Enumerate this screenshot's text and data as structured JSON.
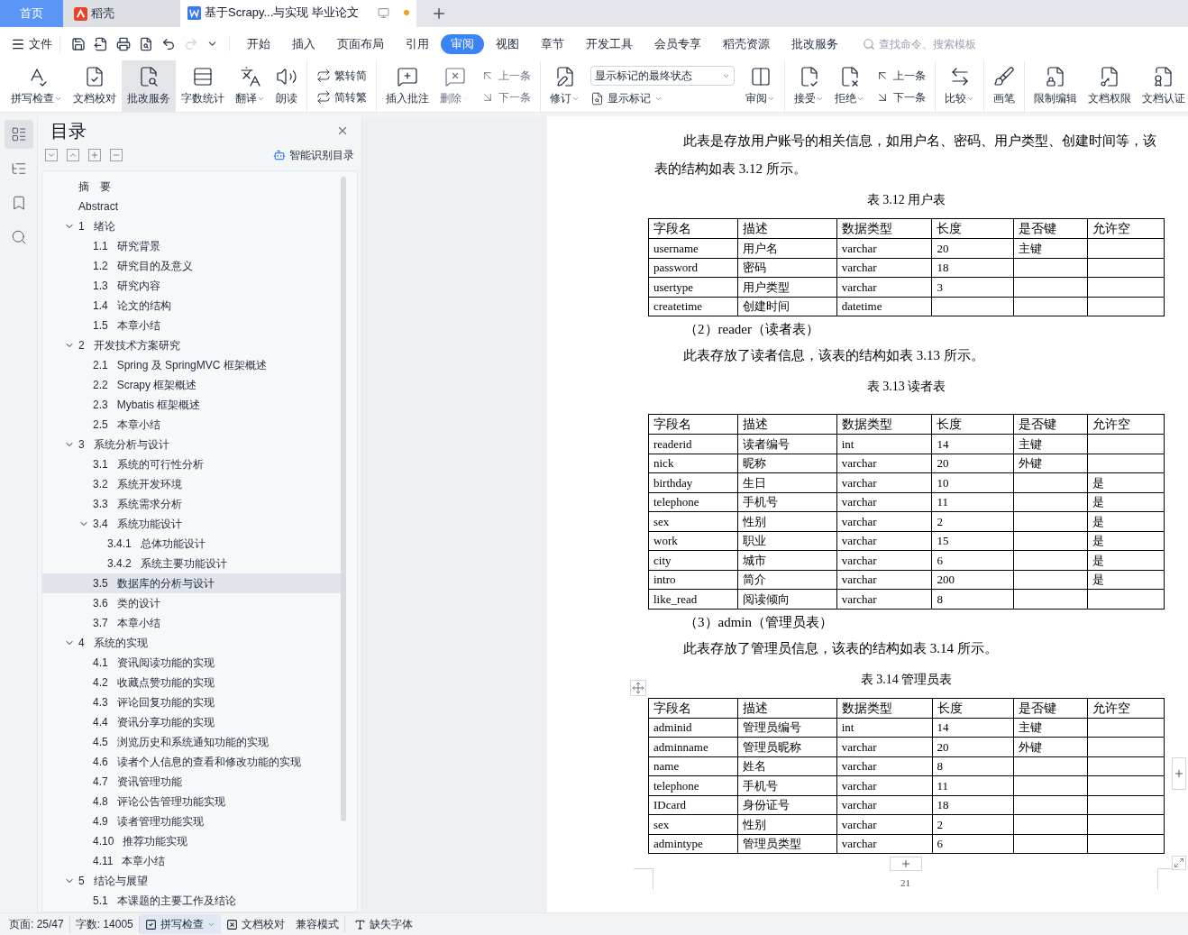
{
  "tabs": [
    {
      "kind": "home",
      "label": "首页",
      "selected": false
    },
    {
      "kind": "app",
      "label": "稻壳",
      "selected": false
    },
    {
      "kind": "doc",
      "label": "基于Scrapy...与实现 毕业论文",
      "selected": true,
      "modified": true
    }
  ],
  "menu": {
    "file": "文件",
    "ribbon_tabs": [
      {
        "label": "开始",
        "selected": false
      },
      {
        "label": "插入",
        "selected": false
      },
      {
        "label": "页面布局",
        "selected": false
      },
      {
        "label": "引用",
        "selected": false
      },
      {
        "label": "审阅",
        "selected": true
      },
      {
        "label": "视图",
        "selected": false
      },
      {
        "label": "章节",
        "selected": false
      },
      {
        "label": "开发工具",
        "selected": false
      },
      {
        "label": "会员专享",
        "selected": false
      },
      {
        "label": "稻壳资源",
        "selected": false
      },
      {
        "label": "批改服务",
        "selected": false
      }
    ],
    "search": {
      "placeholder": "查找命令、搜索模板"
    }
  },
  "ribbon": [
    [
      {
        "kind": "large",
        "label": "拼写检查",
        "caret": true,
        "disabled": false,
        "selected": false
      },
      {
        "kind": "large",
        "label": "文档校对",
        "caret": false,
        "disabled": false,
        "selected": false
      },
      {
        "kind": "large",
        "label": "批改服务",
        "caret": false,
        "disabled": false,
        "selected": true
      },
      {
        "kind": "large",
        "label": "字数统计",
        "caret": false,
        "disabled": false,
        "selected": false
      },
      {
        "kind": "large",
        "label": "翻译",
        "caret": true,
        "disabled": false,
        "selected": false
      },
      {
        "kind": "large",
        "label": "朗读",
        "caret": false,
        "disabled": false,
        "selected": false
      }
    ],
    [
      {
        "kind": "stack",
        "items": [
          {
            "label": "繁转简",
            "disabled": false
          },
          {
            "label": "简转繁",
            "disabled": false
          }
        ]
      }
    ],
    [
      {
        "kind": "large",
        "label": "插入批注",
        "caret": false,
        "disabled": false,
        "selected": false
      },
      {
        "kind": "large",
        "label": "删除",
        "caret": true,
        "disabled": true,
        "selected": false
      },
      {
        "kind": "stack",
        "items": [
          {
            "label": "上一条",
            "disabled": true
          },
          {
            "label": "下一条",
            "disabled": true
          }
        ]
      }
    ],
    [
      {
        "kind": "large",
        "label": "修订",
        "caret": true,
        "disabled": false,
        "selected": false
      },
      {
        "kind": "select",
        "value": "显示标记的最终状态",
        "label": "显示标记"
      },
      {
        "kind": "large",
        "label": "审阅",
        "caret": true,
        "disabled": false,
        "selected": false
      }
    ],
    [
      {
        "kind": "large",
        "label": "接受",
        "caret": true,
        "disabled": false,
        "selected": false
      },
      {
        "kind": "large",
        "label": "拒绝",
        "caret": true,
        "disabled": false,
        "selected": false
      },
      {
        "kind": "stack",
        "items": [
          {
            "label": "上一条",
            "disabled": false
          },
          {
            "label": "下一条",
            "disabled": false
          }
        ]
      }
    ],
    [
      {
        "kind": "large",
        "label": "比较",
        "caret": true,
        "disabled": false,
        "selected": false
      }
    ],
    [
      {
        "kind": "large",
        "label": "画笔",
        "caret": false,
        "disabled": false,
        "selected": false
      }
    ],
    [
      {
        "kind": "large",
        "label": "限制编辑",
        "caret": false,
        "disabled": false,
        "selected": false
      },
      {
        "kind": "large",
        "label": "文档权限",
        "caret": false,
        "disabled": false,
        "selected": false
      },
      {
        "kind": "large",
        "label": "文档认证",
        "caret": false,
        "disabled": false,
        "selected": false
      }
    ]
  ],
  "sidebar": {
    "icons": [
      {
        "selected": true
      },
      {
        "selected": false
      },
      {
        "selected": false
      },
      {
        "selected": false
      }
    ]
  },
  "toc": {
    "title": "目录",
    "smart_button": "智能识别目录",
    "items": [
      {
        "number": "摘　要",
        "selected": false
      },
      {
        "number": "Abstract",
        "selected": false
      },
      {
        "number": "1",
        "title": "绪论",
        "selected": false,
        "expanded": true,
        "children": [
          {
            "number": "1.1",
            "title": "研究背景",
            "selected": false
          },
          {
            "number": "1.2",
            "title": "研究目的及意义",
            "selected": false
          },
          {
            "number": "1.3",
            "title": "研究内容",
            "selected": false
          },
          {
            "number": "1.4",
            "title": "论文的结构",
            "selected": false
          },
          {
            "number": "1.5",
            "title": "本章小结",
            "selected": false
          }
        ]
      },
      {
        "number": "2",
        "title": "开发技术方案研究",
        "selected": false,
        "expanded": true,
        "children": [
          {
            "number": "2.1",
            "title": "Spring 及 SpringMVC 框架概述",
            "selected": false
          },
          {
            "number": "2.2",
            "title": "Scrapy 框架概述",
            "selected": false
          },
          {
            "number": "2.3",
            "title": "Mybatis 框架概述",
            "selected": false
          },
          {
            "number": "2.5",
            "title": "本章小结",
            "selected": false
          }
        ]
      },
      {
        "number": "3",
        "title": "系统分析与设计",
        "selected": false,
        "expanded": true,
        "children": [
          {
            "number": "3.1",
            "title": "系统的可行性分析",
            "selected": false
          },
          {
            "number": "3.2",
            "title": "系统开发环境",
            "selected": false
          },
          {
            "number": "3.3",
            "title": "系统需求分析",
            "selected": false
          },
          {
            "number": "3.4",
            "title": "系统功能设计",
            "selected": false,
            "expanded": true,
            "children": [
              {
                "number": "3.4.1",
                "title": "总体功能设计",
                "selected": false
              },
              {
                "number": "3.4.2",
                "title": "系统主要功能设计",
                "selected": false
              }
            ]
          },
          {
            "number": "3.5",
            "title": "数据库的分析与设计",
            "selected": true
          },
          {
            "number": "3.6",
            "title": "类的设计",
            "selected": false
          },
          {
            "number": "3.7",
            "title": "本章小结",
            "selected": false
          }
        ]
      },
      {
        "number": "4",
        "title": "系统的实现",
        "selected": false,
        "expanded": true,
        "children": [
          {
            "number": "4.1",
            "title": "资讯阅读功能的实现",
            "selected": false
          },
          {
            "number": "4.2",
            "title": "收藏点赞功能的实现",
            "selected": false
          },
          {
            "number": "4.3",
            "title": "评论回复功能的实现",
            "selected": false
          },
          {
            "number": "4.4",
            "title": "资讯分享功能的实现",
            "selected": false
          },
          {
            "number": "4.5",
            "title": "浏览历史和系统通知功能的实现",
            "selected": false
          },
          {
            "number": "4.6",
            "title": "读者个人信息的查看和修改功能的实现",
            "selected": false
          },
          {
            "number": "4.7",
            "title": "资讯管理功能",
            "selected": false
          },
          {
            "number": "4.8",
            "title": "评论公告管理功能实现",
            "selected": false
          },
          {
            "number": "4.9",
            "title": "读者管理功能实现",
            "selected": false
          },
          {
            "number": "4.10",
            "title": "推荐功能实现",
            "selected": false
          },
          {
            "number": "4.11",
            "title": "本章小结",
            "selected": false
          }
        ]
      },
      {
        "number": "5",
        "title": "结论与展望",
        "selected": false,
        "expanded": true,
        "children": [
          {
            "number": "5.1",
            "title": "本课题的主要工作及结论",
            "selected": false
          }
        ]
      }
    ]
  },
  "document": {
    "page_number": "21",
    "blocks": [
      {
        "kind": "paragraph",
        "text": "此表是存放用户账号的相关信息，如用户名、密码、用户类型、创建时间等，该表的结构如表 3.12 所示。"
      },
      {
        "kind": "caption",
        "text": "表 3.12 用户表"
      },
      {
        "kind": "table",
        "columns": [
          "字段名",
          "描述",
          "数据类型",
          "长度",
          "是否键",
          "允许空"
        ],
        "rows": [
          [
            "username",
            "用户名",
            "varchar",
            "20",
            "主键",
            null
          ],
          [
            "password",
            "密码",
            "varchar",
            "18",
            null,
            null
          ],
          [
            "usertype",
            "用户类型",
            "varchar",
            "3",
            null,
            null
          ],
          [
            "createtime",
            "创建时间",
            "datetime",
            null,
            null,
            null
          ]
        ]
      },
      {
        "kind": "heading",
        "text": "（2）reader（读者表）"
      },
      {
        "kind": "paragraph",
        "text": "此表存放了读者信息，该表的结构如表 3.13 所示。"
      },
      {
        "kind": "caption",
        "text": "表 3.13 读者表"
      },
      {
        "kind": "table",
        "columns": [
          "字段名",
          "描述",
          "数据类型",
          "长度",
          "是否键",
          "允许空"
        ],
        "rows": [
          [
            "readerid",
            "读者编号",
            "int",
            "14",
            "主键",
            null
          ],
          [
            "nick",
            "昵称",
            "varchar",
            "20",
            "外键",
            null
          ],
          [
            "birthday",
            "生日",
            "varchar",
            "10",
            null,
            "是"
          ],
          [
            "telephone",
            "手机号",
            "varchar",
            "11",
            null,
            "是"
          ],
          [
            "sex",
            "性别",
            "varchar",
            "2",
            null,
            "是"
          ],
          [
            "work",
            "职业",
            "varchar",
            "15",
            null,
            "是"
          ],
          [
            "city",
            "城市",
            "varchar",
            "6",
            null,
            "是"
          ],
          [
            "intro",
            "简介",
            "varchar",
            "200",
            null,
            "是"
          ],
          [
            "like_read",
            "阅读倾向",
            "varchar",
            "8",
            null,
            null
          ]
        ]
      },
      {
        "kind": "heading",
        "text": "（3）admin（管理员表）"
      },
      {
        "kind": "paragraph",
        "text": "此表存放了管理员信息，该表的结构如表 3.14 所示。"
      },
      {
        "kind": "caption",
        "text": "表 3.14 管理员表"
      },
      {
        "kind": "table",
        "columns": [
          "字段名",
          "描述",
          "数据类型",
          "长度",
          "是否键",
          "允许空"
        ],
        "rows": [
          [
            "adminid",
            "管理员编号",
            "int",
            "14",
            "主键",
            null
          ],
          [
            "adminname",
            "管理员昵称",
            "varchar",
            "20",
            "外键",
            null
          ],
          [
            "name",
            "姓名",
            "varchar",
            "8",
            null,
            null
          ],
          [
            "telephone",
            "手机号",
            "varchar",
            "11",
            null,
            null
          ],
          [
            "IDcard",
            "身份证号",
            "varchar",
            "18",
            null,
            null
          ],
          [
            "sex",
            "性别",
            "varchar",
            "2",
            null,
            null
          ],
          [
            "admintype",
            "管理员类型",
            "varchar",
            "6",
            null,
            null
          ]
        ]
      }
    ]
  },
  "status_bar": [
    {
      "kind": "text",
      "label": "页面: 25/47"
    },
    {
      "kind": "text",
      "label": "字数: 14005"
    },
    {
      "kind": "toggle",
      "label": "拼写检查",
      "caret": true,
      "on": true
    },
    {
      "kind": "toggle",
      "label": "文档校对",
      "caret": false,
      "on": false
    },
    {
      "kind": "text",
      "label": "兼容模式"
    },
    {
      "kind": "button",
      "label": "缺失字体"
    }
  ]
}
